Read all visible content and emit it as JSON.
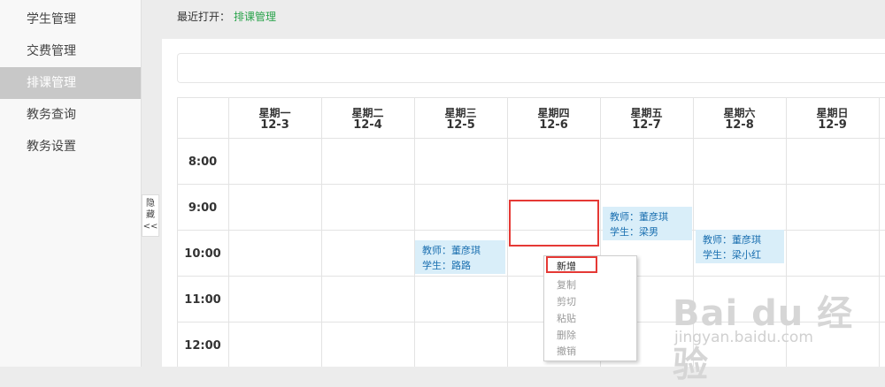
{
  "sidebar": {
    "items": [
      {
        "label": "学生管理",
        "active": false
      },
      {
        "label": "交费管理",
        "active": false
      },
      {
        "label": "排课管理",
        "active": true
      },
      {
        "label": "教务查询",
        "active": false
      },
      {
        "label": "教务设置",
        "active": false
      }
    ],
    "hide_toggle": {
      "label_1": "隐",
      "label_2": "藏",
      "arrows": "<<"
    }
  },
  "recent": {
    "label": "最近打开：",
    "link": "排课管理"
  },
  "schedule": {
    "days": [
      {
        "weekday": "星期一",
        "date": "12-3"
      },
      {
        "weekday": "星期二",
        "date": "12-4"
      },
      {
        "weekday": "星期三",
        "date": "12-5"
      },
      {
        "weekday": "星期四",
        "date": "12-6"
      },
      {
        "weekday": "星期五",
        "date": "12-7"
      },
      {
        "weekday": "星期六",
        "date": "12-8"
      },
      {
        "weekday": "星期日",
        "date": "12-9"
      }
    ],
    "times": [
      "8:00",
      "9:00",
      "10:00",
      "11:00",
      "12:00"
    ],
    "lessons": [
      {
        "teacher": "教师：董彦琪",
        "student": "学生：路路"
      },
      {
        "teacher": "教师：董彦琪",
        "student": "学生：梁男"
      },
      {
        "teacher": "教师：董彦琪",
        "student": "学生：梁小红"
      }
    ]
  },
  "context_menu": {
    "items": [
      {
        "label": "新增",
        "enabled": true
      },
      {
        "label": "复制",
        "enabled": false
      },
      {
        "label": "剪切",
        "enabled": false
      },
      {
        "label": "粘贴",
        "enabled": false
      },
      {
        "label": "删除",
        "enabled": false
      },
      {
        "label": "撤销",
        "enabled": false
      }
    ]
  },
  "watermark": {
    "logo": "Bai du 经验",
    "url": "jingyan.baidu.com"
  },
  "colors": {
    "accent_green": "#2aa34b",
    "highlight_red": "#e53935",
    "lesson_bg": "#d9eef9",
    "lesson_text": "#1a6fb0",
    "active_nav": "#c8c8c8"
  }
}
